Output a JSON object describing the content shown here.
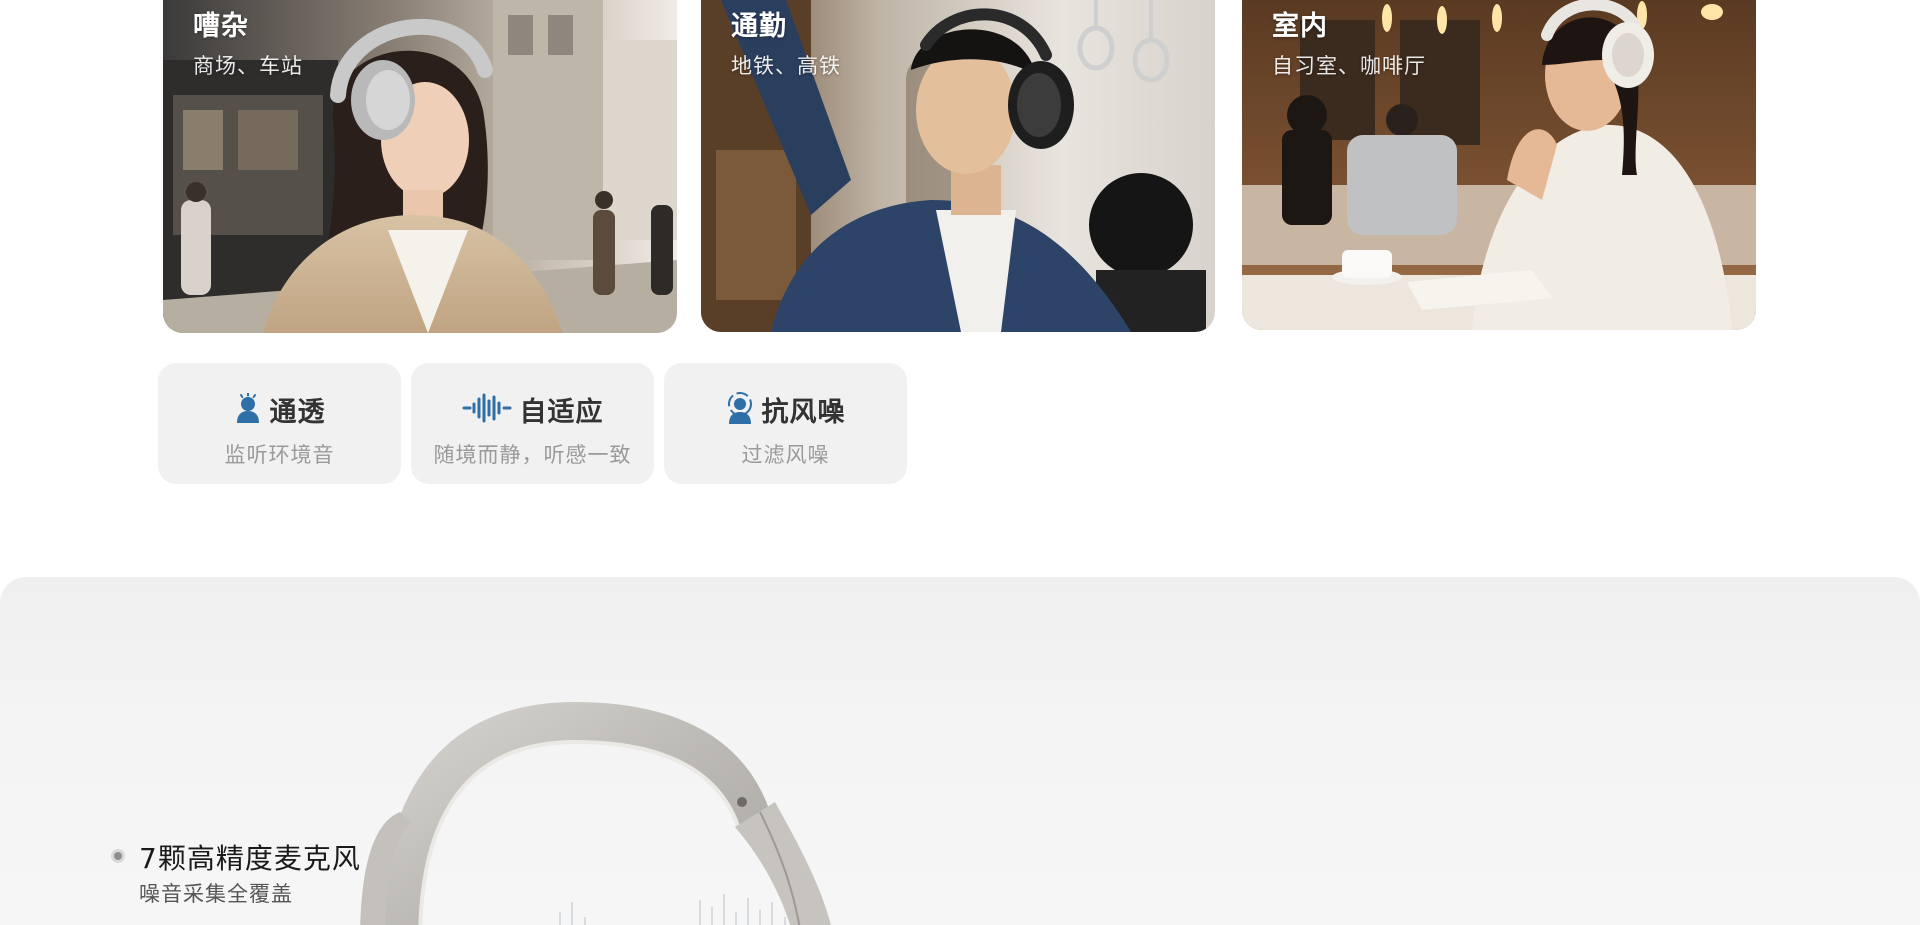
{
  "scenes": [
    {
      "title": "嘈杂",
      "subtitle": "商场、车站"
    },
    {
      "title": "通勤",
      "subtitle": "地铁、高铁"
    },
    {
      "title": "室内",
      "subtitle": "自习室、咖啡厅"
    }
  ],
  "modes": [
    {
      "name": "通透",
      "desc": "监听环境音",
      "icon": "person-sound-icon"
    },
    {
      "name": "自适应",
      "desc": "随境而静，听感一致",
      "icon": "waveform-icon"
    },
    {
      "name": "抗风噪",
      "desc": "过滤风噪",
      "icon": "person-wind-icon"
    }
  ],
  "mic_feature": {
    "title": "7颗高精度麦克风",
    "subtitle": "噪音采集全覆盖"
  },
  "colors": {
    "mode_icon": "#2e6fa8",
    "chip_bg": "#f1f1f1",
    "section_bg": "#f2f2f2"
  }
}
